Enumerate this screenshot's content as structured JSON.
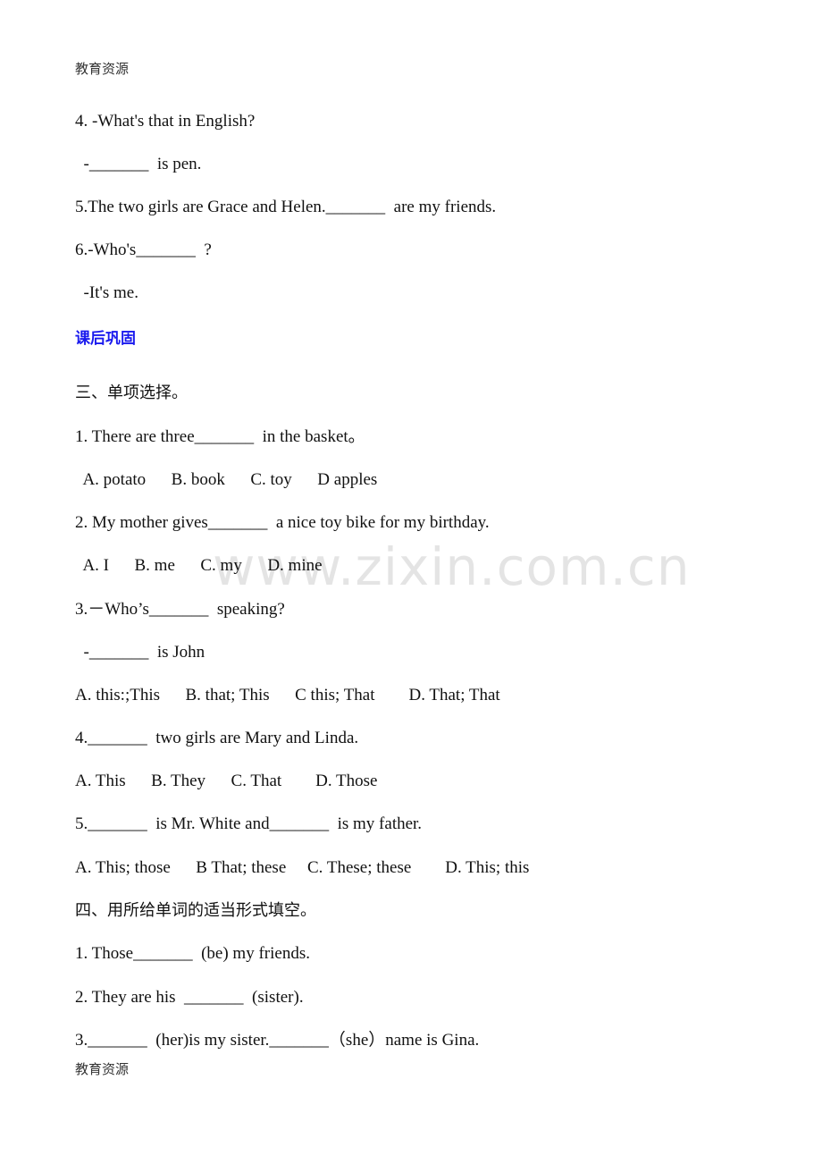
{
  "header": "教育资源",
  "footer": "教育资源",
  "watermark": "www.zixin.com.cn",
  "lines": [
    "4. -What's that in English?",
    "  -_______  is pen.",
    "5.The two girls are Grace and Helen._______  are my friends.",
    "6.-Who's_______  ?",
    "  -It's me."
  ],
  "section_heading": "课后巩固",
  "section3": {
    "title": "三、单项选择。",
    "items": [
      "1. There are three_______  in the basket。",
      "  A. potato      B. book      C. toy      D apples",
      "2. My mother gives_______  a nice toy bike for my birthday.",
      "  A. I      B. me      C. my      D. mine",
      "3.－Who’s_______  speaking?",
      "  -_______  is John",
      "A. this:;This      B. that; This      C this; That        D. That; That",
      "4._______  two girls are Mary and Linda.",
      "A. This      B. They      C. That        D. Those",
      "5._______  is Mr. White and_______  is my father.",
      "A. This; those      B That; these     C. These; these        D. This; this"
    ]
  },
  "section4": {
    "title": "四、用所给单词的适当形式填空。",
    "items": [
      "1. Those_______  (be) my friends.",
      "2. They are his  _______  (sister).",
      "3._______  (her)is my sister._______（she）name is Gina."
    ]
  }
}
